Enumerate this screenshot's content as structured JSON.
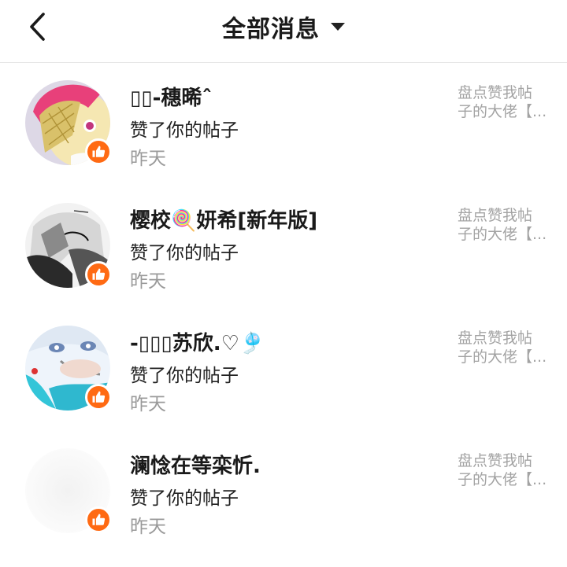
{
  "header": {
    "title": "全部消息",
    "back_icon": "chevron-left-icon",
    "dropdown_icon": "caret-down-icon"
  },
  "accent_color": "#ff6a13",
  "messages": [
    {
      "name": "▯▯-穗晞ˆ",
      "action": "赞了你的帖子",
      "time": "昨天",
      "snippet_line1": "盘点赞我帖",
      "snippet_line2": "子的大佬【...",
      "badge_icon": "thumbs-up-icon"
    },
    {
      "name": "樱校🍭妍希[新年版]",
      "action": "赞了你的帖子",
      "time": "昨天",
      "snippet_line1": "盘点赞我帖",
      "snippet_line2": "子的大佬【...",
      "badge_icon": "thumbs-up-icon"
    },
    {
      "name": "-▯▯▯苏欣.♡🎐",
      "action": "赞了你的帖子",
      "time": "昨天",
      "snippet_line1": "盘点赞我帖",
      "snippet_line2": "子的大佬【...",
      "badge_icon": "thumbs-up-icon"
    },
    {
      "name": "澜惗在等栾忻.",
      "action": "赞了你的帖子",
      "time": "昨天",
      "snippet_line1": "盘点赞我帖",
      "snippet_line2": "子的大佬【...",
      "badge_icon": "thumbs-up-icon"
    }
  ]
}
